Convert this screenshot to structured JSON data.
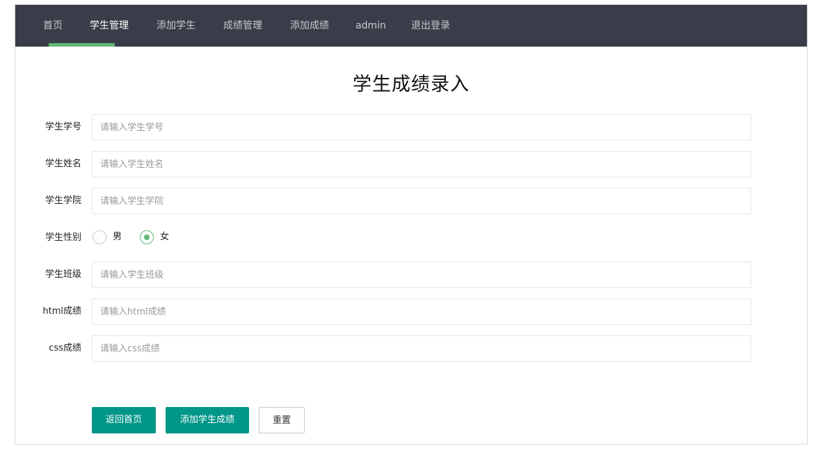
{
  "nav": {
    "items": [
      {
        "label": "首页"
      },
      {
        "label": "学生管理"
      },
      {
        "label": "添加学生"
      },
      {
        "label": "成绩管理"
      },
      {
        "label": "添加成绩"
      },
      {
        "label": "admin"
      },
      {
        "label": "退出登录"
      }
    ],
    "active_index": 1,
    "colors": {
      "bar": "#393d49",
      "underline": "#5fb878"
    }
  },
  "form": {
    "title": "学生成绩录入",
    "fields": [
      {
        "label": "学生学号",
        "placeholder": "请输入学生学号",
        "value": ""
      },
      {
        "label": "学生姓名",
        "placeholder": "请输入学生姓名",
        "value": ""
      },
      {
        "label": "学生学院",
        "placeholder": "请输入学生学院",
        "value": ""
      },
      {
        "label": "学生班级",
        "placeholder": "请输入学生班级",
        "value": ""
      },
      {
        "label": "html成绩",
        "placeholder": "请输入html成绩",
        "value": ""
      },
      {
        "label": "css成绩",
        "placeholder": "请输入css成绩",
        "value": ""
      }
    ],
    "gender": {
      "label": "学生性别",
      "options": [
        "男",
        "女"
      ],
      "selected": "女"
    },
    "buttons": {
      "back": "返回首页",
      "submit": "添加学生成绩",
      "reset": "重置"
    },
    "colors": {
      "primary": "#009688",
      "radio_on": "#5fb878"
    }
  }
}
